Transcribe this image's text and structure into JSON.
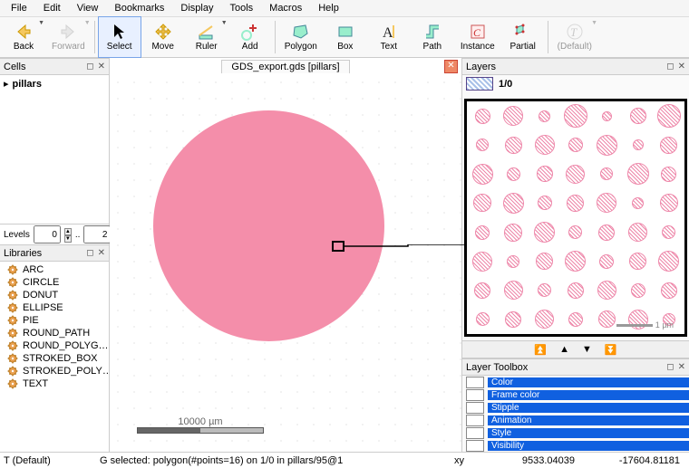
{
  "menu": {
    "items": [
      "File",
      "Edit",
      "View",
      "Bookmarks",
      "Display",
      "Tools",
      "Macros",
      "Help"
    ]
  },
  "toolbar": {
    "back": "Back",
    "forward": "Forward",
    "select": "Select",
    "move": "Move",
    "ruler": "Ruler",
    "add": "Add",
    "polygon": "Polygon",
    "box": "Box",
    "text": "Text",
    "path": "Path",
    "instance": "Instance",
    "partial": "Partial",
    "default": "(Default)"
  },
  "panels": {
    "cells": "Cells",
    "libraries": "Libraries",
    "layers": "Layers",
    "layer_toolbox": "Layer Toolbox"
  },
  "cells": {
    "items": [
      "pillars"
    ]
  },
  "levels": {
    "label": "Levels",
    "low": "0",
    "dots": "..",
    "high": "2"
  },
  "libraries": {
    "items": [
      "ARC",
      "CIRCLE",
      "DONUT",
      "ELLIPSE",
      "PIE",
      "ROUND_PATH",
      "ROUND_POLYG…",
      "STROKED_BOX",
      "STROKED_POLY…",
      "TEXT"
    ]
  },
  "tab": {
    "title": "GDS_export.gds [pillars]"
  },
  "layers": {
    "active": "1/0"
  },
  "scalebar": {
    "main_label": "10000",
    "main_unit": "µm",
    "zoom_label": "1",
    "zoom_unit": "µm"
  },
  "layer_toolbox": {
    "props": [
      "Color",
      "Frame color",
      "Stipple",
      "Animation",
      "Style",
      "Visibility"
    ]
  },
  "status": {
    "left": "T  (Default)",
    "mid": "G   selected: polygon(#points=16) on 1/0 in pillars/95@1",
    "xy": "xy",
    "x": "9533.04039",
    "y": "-17604.81181"
  },
  "zoom_sizes": [
    [
      15,
      20,
      11,
      24,
      9,
      16,
      24
    ],
    [
      12,
      17,
      20,
      14,
      21,
      10,
      17
    ],
    [
      21,
      13,
      16,
      19,
      12,
      22,
      15
    ],
    [
      18,
      21,
      14,
      17,
      20,
      11,
      18
    ],
    [
      14,
      18,
      21,
      13,
      16,
      19,
      13
    ],
    [
      20,
      12,
      17,
      21,
      14,
      17,
      21
    ],
    [
      16,
      19,
      13,
      16,
      19,
      14,
      16
    ],
    [
      13,
      16,
      19,
      14,
      17,
      20,
      12
    ]
  ]
}
